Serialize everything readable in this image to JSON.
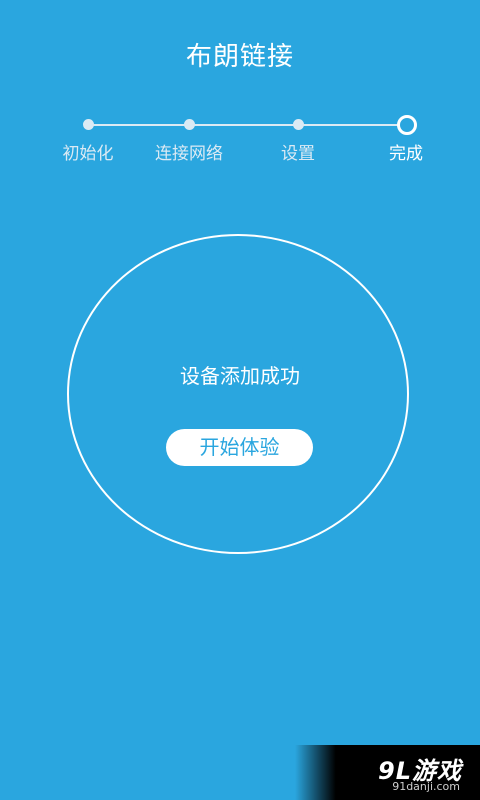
{
  "header": {
    "title": "布朗链接"
  },
  "steps": [
    {
      "label": "初始化",
      "state": "done"
    },
    {
      "label": "连接网络",
      "state": "done"
    },
    {
      "label": "设置",
      "state": "done"
    },
    {
      "label": "完成",
      "state": "current"
    }
  ],
  "main": {
    "status_text": "设备添加成功",
    "start_button_label": "开始体验"
  },
  "watermark": {
    "brand": "9L游戏",
    "url": "91danji.com"
  },
  "colors": {
    "background": "#2aa6df",
    "foreground": "#ffffff",
    "inactive": "#dbeaf4"
  }
}
